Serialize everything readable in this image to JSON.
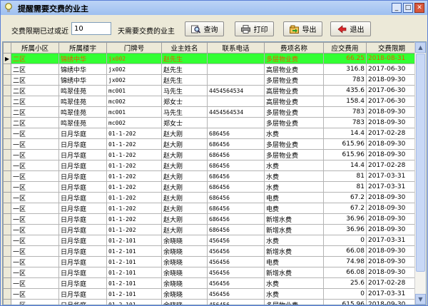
{
  "window": {
    "title": "提醒需要交费的业主"
  },
  "toolbar": {
    "label_before": "交费限期已过或近",
    "days_value": "10",
    "label_after": "天需要交费的业主",
    "query_label": "查询",
    "print_label": "打印",
    "export_label": "导出",
    "exit_label": "退出"
  },
  "grid": {
    "columns": [
      "所属小区",
      "所属楼宇",
      "门牌号",
      "业主姓名",
      "联系电话",
      "费项名称",
      "应交费用",
      "交费限期"
    ],
    "rows": [
      [
        "二区",
        "锦绣中华",
        "jx002",
        "赵先生",
        "",
        "多层物业费",
        "66.25",
        "2018-08-31"
      ],
      [
        "二区",
        "锦绣中华",
        "jx002",
        "赵先生",
        "",
        "高层物业费",
        "316.8",
        "2017-06-30"
      ],
      [
        "二区",
        "锦绣中华",
        "jx002",
        "赵先生",
        "",
        "多层物业费",
        "783",
        "2018-09-30"
      ],
      [
        "二区",
        "鸣翠佳苑",
        "mc001",
        "马先生",
        "4454564534",
        "高层物业费",
        "435.6",
        "2017-06-30"
      ],
      [
        "二区",
        "鸣翠佳苑",
        "mc002",
        "郑女士",
        "",
        "高层物业费",
        "158.4",
        "2017-06-30"
      ],
      [
        "二区",
        "鸣翠佳苑",
        "mc001",
        "马先生",
        "4454564534",
        "多层物业费",
        "783",
        "2018-09-30"
      ],
      [
        "二区",
        "鸣翠佳苑",
        "mc002",
        "郑女士",
        "",
        "多层物业费",
        "783",
        "2018-09-30"
      ],
      [
        "一区",
        "日月华庭",
        "01-1-202",
        "赵大刚",
        "686456",
        "水费",
        "14.4",
        "2017-02-28"
      ],
      [
        "一区",
        "日月华庭",
        "01-1-202",
        "赵大刚",
        "686456",
        "多层物业费",
        "615.96",
        "2018-09-30"
      ],
      [
        "一区",
        "日月华庭",
        "01-1-202",
        "赵大刚",
        "686456",
        "多层物业费",
        "615.96",
        "2018-09-30"
      ],
      [
        "一区",
        "日月华庭",
        "01-1-202",
        "赵大刚",
        "686456",
        "水费",
        "14.4",
        "2017-02-28"
      ],
      [
        "一区",
        "日月华庭",
        "01-1-202",
        "赵大刚",
        "686456",
        "水费",
        "81",
        "2017-03-31"
      ],
      [
        "一区",
        "日月华庭",
        "01-1-202",
        "赵大刚",
        "686456",
        "水费",
        "81",
        "2017-03-31"
      ],
      [
        "一区",
        "日月华庭",
        "01-1-202",
        "赵大刚",
        "686456",
        "电费",
        "67.2",
        "2018-09-30"
      ],
      [
        "一区",
        "日月华庭",
        "01-1-202",
        "赵大刚",
        "686456",
        "电费",
        "67.2",
        "2018-09-30"
      ],
      [
        "一区",
        "日月华庭",
        "01-1-202",
        "赵大刚",
        "686456",
        "新增水费",
        "36.96",
        "2018-09-30"
      ],
      [
        "一区",
        "日月华庭",
        "01-1-202",
        "赵大刚",
        "686456",
        "新增水费",
        "36.96",
        "2018-09-30"
      ],
      [
        "一区",
        "日月华庭",
        "01-2-101",
        "余晓晓",
        "456456",
        "水费",
        "0",
        "2017-03-31"
      ],
      [
        "一区",
        "日月华庭",
        "01-2-101",
        "余晓晓",
        "456456",
        "新增水费",
        "66.08",
        "2018-09-30"
      ],
      [
        "一区",
        "日月华庭",
        "01-2-101",
        "余晓晓",
        "456456",
        "电费",
        "74.98",
        "2018-09-30"
      ],
      [
        "一区",
        "日月华庭",
        "01-2-101",
        "余晓晓",
        "456456",
        "新增水费",
        "66.08",
        "2018-09-30"
      ],
      [
        "一区",
        "日月华庭",
        "01-2-101",
        "余晓晓",
        "456456",
        "水费",
        "25.6",
        "2017-02-28"
      ],
      [
        "一区",
        "日月华庭",
        "01-2-101",
        "余晓晓",
        "456456",
        "水费",
        "0",
        "2017-03-31"
      ],
      [
        "一区",
        "日月华庭",
        "01-2-101",
        "余晓晓",
        "456456",
        "多层物业费",
        "615.96",
        "2018-09-30"
      ],
      [
        "一区",
        "日月华庭",
        "01-2-101",
        "余晓晓",
        "456456",
        "多层物业费",
        "615.96",
        "2018-09-30"
      ]
    ]
  },
  "colors": {
    "selected_row_bg": "#33ff33",
    "selected_row_text": "#e65a00",
    "title_gradient": "#9ec0f0"
  },
  "icons": {
    "app": "lightbulb-icon",
    "query": "search-icon",
    "print": "printer-icon",
    "export": "export-icon",
    "exit": "exit-icon"
  }
}
